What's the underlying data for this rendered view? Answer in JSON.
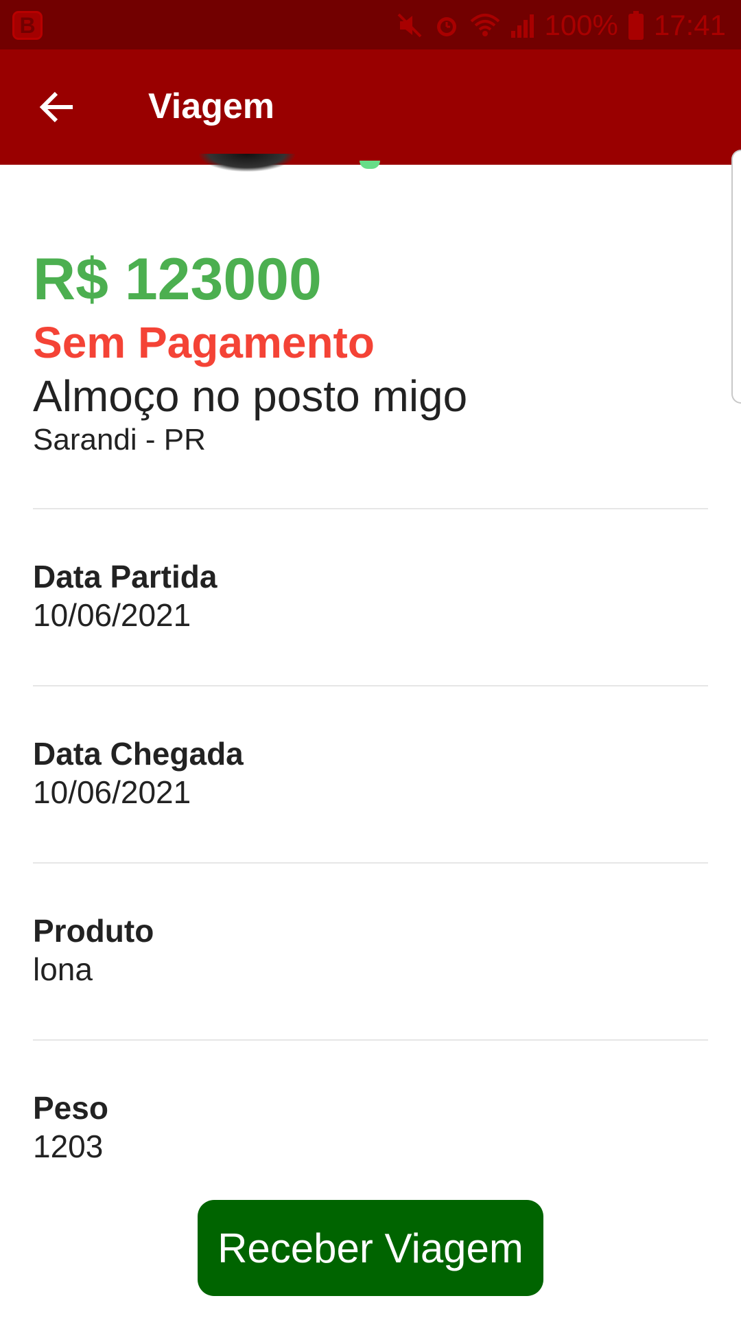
{
  "status_bar": {
    "battery": "100%",
    "time": "17:41",
    "app_icon_letter": "B",
    "icons": [
      "mute-icon",
      "alarm-icon",
      "wifi-icon",
      "signal-icon",
      "battery-icon"
    ]
  },
  "app_bar": {
    "title": "Viagem",
    "back_icon": "arrow-left-icon"
  },
  "trip": {
    "price": "R$ 123000",
    "payment_status": "Sem Pagamento",
    "title": "Almoço no posto migo",
    "location": "Sarandi - PR"
  },
  "fields": {
    "departure": {
      "label": "Data Partida",
      "value": "10/06/2021"
    },
    "arrival": {
      "label": "Data Chegada",
      "value": "10/06/2021"
    },
    "product": {
      "label": "Produto",
      "value": "lona"
    },
    "weight": {
      "label": "Peso",
      "value": "1203"
    }
  },
  "actions": {
    "receive_label": "Receber Viagem"
  },
  "colors": {
    "status_bar": "#720000",
    "app_bar": "#990000",
    "price": "#4caf50",
    "payment_status": "#f44336",
    "button": "#006400"
  }
}
